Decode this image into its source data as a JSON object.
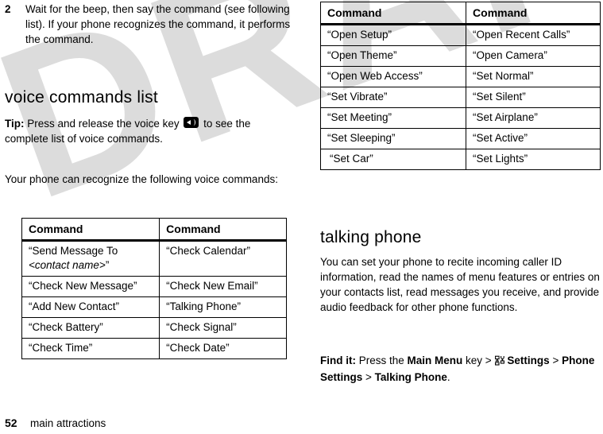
{
  "watermark": {
    "text": "DRAFT"
  },
  "left_column": {
    "step": {
      "number": "2",
      "text": "Wait for the beep, then say the command (see following list). If your phone recognizes the command, it performs the command."
    },
    "section_heading": "voice commands list",
    "tip": {
      "label": "Tip:",
      "text_before": " Press and release the voice key",
      "icon": "voice-key-icon",
      "text_after": "to see the complete list of voice commands."
    },
    "intro": "Your phone can recognize the following voice commands:",
    "table": {
      "headers": [
        "Command",
        "Command"
      ],
      "rows": [
        [
          "“Send Message To <contact name>”",
          "“Check Calendar”"
        ],
        [
          "“Check New Message”",
          "“Check New Email”"
        ],
        [
          "“Add New Contact”",
          "“Talking Phone”"
        ],
        [
          "“Check Battery”",
          "“Check Signal”"
        ],
        [
          "“Check Time”",
          "“Check Date”"
        ]
      ],
      "row0_col0_plain": "“Send Message To ",
      "row0_col0_italic": "<contact name>",
      "row0_col0_tail": "”"
    }
  },
  "right_column": {
    "table": {
      "headers": [
        "Command",
        "Command"
      ],
      "rows": [
        [
          "“Open Setup”",
          "“Open Recent Calls”"
        ],
        [
          "“Open Theme”",
          "“Open Camera”"
        ],
        [
          "“Open Web Access”",
          "“Set Normal”"
        ],
        [
          "“Set Vibrate”",
          "“Set Silent”"
        ],
        [
          "“Set Meeting”",
          "“Set Airplane”"
        ],
        [
          "“Set Sleeping”",
          "“Set Active”"
        ],
        [
          "“Set Car”",
          "“Set Lights”"
        ]
      ]
    },
    "section_heading": "talking phone",
    "body": "You can set your phone to recite incoming caller ID information, read the names of menu features or entries on your contacts list, read messages you receive, and provide audio feedback for other phone functions.",
    "find_it": {
      "label": "Find it:",
      "text_1": " Press the ",
      "key_name": "Main Menu",
      "text_2": " key > ",
      "icon": "settings-tools-icon",
      "menu_1": "Settings",
      "sep_1": " > ",
      "menu_2": "Phone Settings",
      "sep_2": " > ",
      "menu_3": "Talking Phone",
      "period": "."
    }
  },
  "footer": {
    "page_number": "52",
    "chapter": "main attractions"
  }
}
